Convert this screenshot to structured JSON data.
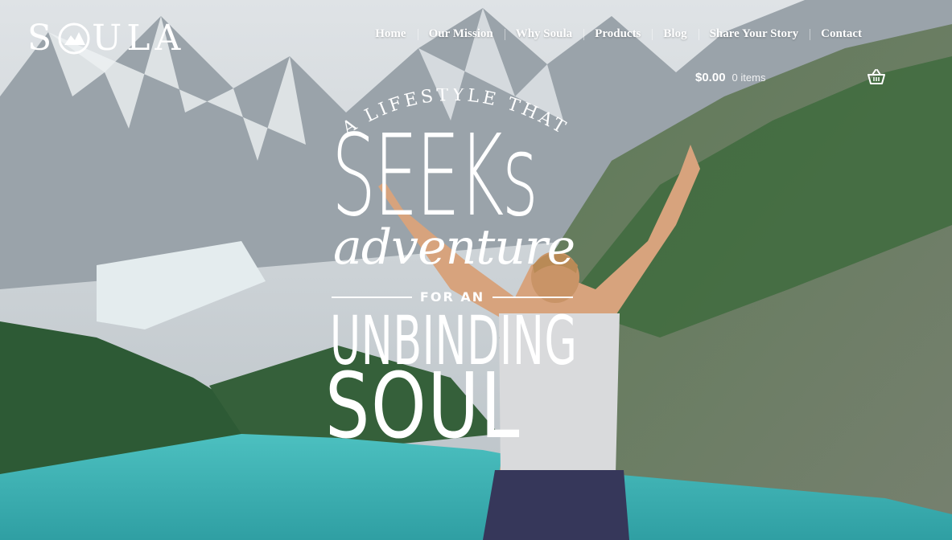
{
  "brand": {
    "logo_text": "SOULA",
    "logo_left": "S",
    "logo_right": "ULA"
  },
  "nav": {
    "items": [
      {
        "label": "Home"
      },
      {
        "label": "Our Mission"
      },
      {
        "label": "Why Soula"
      },
      {
        "label": "Products"
      },
      {
        "label": "Blog"
      },
      {
        "label": "Share Your Story"
      },
      {
        "label": "Contact"
      }
    ]
  },
  "cart": {
    "amount": "$0.00",
    "items": "0 items",
    "icon": "basket-icon"
  },
  "hero": {
    "arc_text": "A LIFESTYLE THAT",
    "seeks": "SEEKs",
    "adventure": "adventure",
    "for_an": "FOR AN",
    "unbinding": "UNBINDING",
    "soul": "SOUL"
  },
  "colors": {
    "text": "#ffffff",
    "lake": "#3cb3b2",
    "forest": "#2f5a36",
    "mountain": "#8a9096"
  }
}
